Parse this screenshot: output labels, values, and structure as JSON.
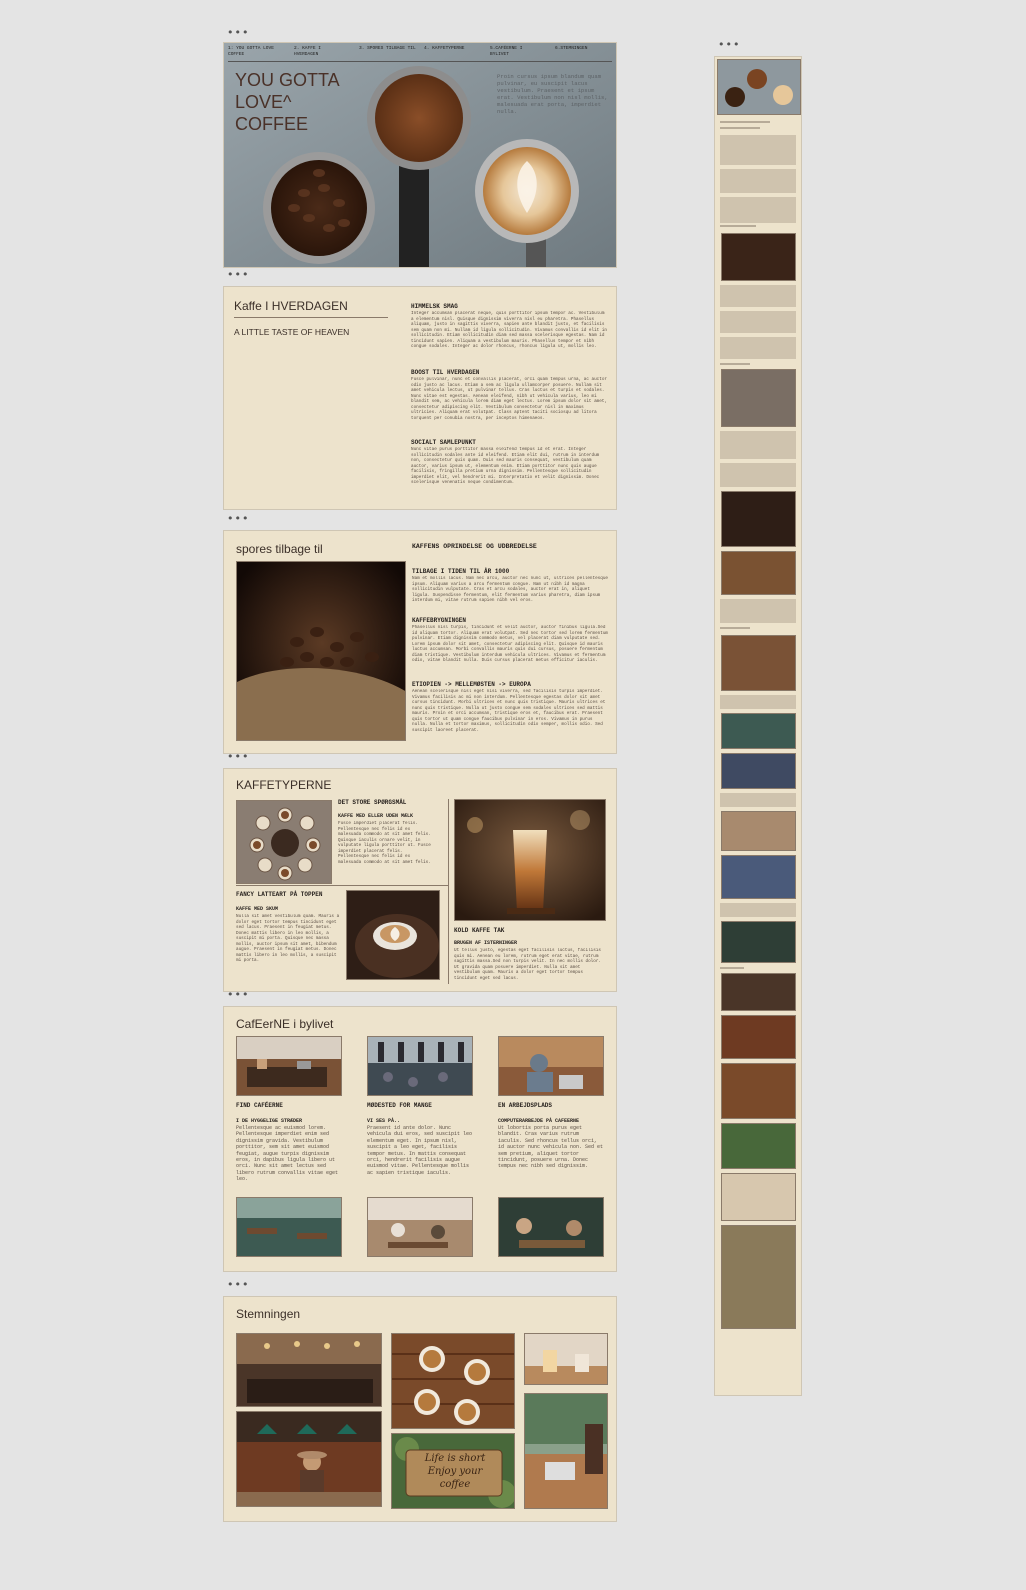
{
  "hero": {
    "nav": [
      "1: YOU GOTTA LOVE COFFEE",
      "2. KAFFE I HVERDAGEN",
      "3. SPORES TILBAGE TIL",
      "4. KAFFETYPERNE",
      "5.CAFÉERNE I BYLIVET",
      "6.STEMNINGEN"
    ],
    "title_lines": [
      "YOU GOTTA",
      "LOVE^",
      "COFFEE"
    ],
    "intro": "Proin cursus ipsum blandum quam pulvinar, eu suscipit lacus vestibulum. Praesent et ipsum erat. Vestibulum non nisl mollis, malesuada erat porta, imperdiet nulla."
  },
  "hverdagen": {
    "title": "Kaffe I HVERDAGEN",
    "subtitle": "A LITTLE TASTE OF HEAVEN",
    "sections": [
      {
        "heading": "HIMMELSK SMAG",
        "text": "Integer accumsan placerat neque, quis porttitor ipsum tempor ac. Vestibulum a elementum nisl. Quisque dignissim viverra nisl eu pharetra. Phasellus aliquam, justo in sagittis viverra, sapien ante blandit justo, et facilisis sem quam non mi. Nullam id ligula sollicitudin. Vivamus convallis id elit in sollicitudin. Etiam sollicitudin diam sed massa scelerisque egestas. Nam id tincidunt sapien. Aliquam a vestibulum mauris. Phasellus tempor et nibh congue sodales. Integer ac dolor rhoncus, rhoncus ligula ut, mollis leo."
      },
      {
        "heading": "BOOST TIL HVERDAGEN",
        "text": "Fusce pulvinar, nunc et convallis placerat, orci quam tempus urna, ac auctor odio justo ac lacus. Etiam a sem ac ligula ullamcorper posuere. Nullam sit amet vehicula lectus, ut pulvinar tellus. Cras luctus et turpis et sodales. Nunc vitae est egestas. Aenean eleifend, nibh ut vehicula varius, leo mi blandit sem, ac vehicula lorem diam eget lectus. Lorem ipsum dolor sit amet, consectetur adipiscing elit. Vestibulum consectetur nisl in maximus ultricies. Aliquam erat volutpat. Class aptent taciti sociosqu ad litora torquent per conubia nostra, per inceptos himenaeos."
      },
      {
        "heading": "SOCIALT SAMLEPUNKT",
        "text": "Nunc vitae purus porttitor massa eleifend tempus id et erat. Integer sollicitudin sodales ante id eleifend. Etiam elit dui, rutrum in interdum non, consectetur quis quam. Duis sed mauris consequat, vestibulum quam auctor, varius ipsum ut, elementum enim. Etiam porttitor nunc quis augue facilisis, fringilla pretium urna dignissim. Pellentesque sollicitudin imperdiet elit, vel hendrerit mi. Interpretatio et velit dignissim. Donec scelerisque venenatis neque condimentum."
      }
    ]
  },
  "spores": {
    "title": "spores tilbage til",
    "main_heading": "KAFFENS OPRINDELSE OG UDBREDELSE",
    "sections": [
      {
        "heading": "TILBAGE I TIDEN TIL ÅR 1000",
        "text": "Nam et mollis lacus. Nam nec arcu, auctor nec nunc ut, ultrices pellentesque ipsum. Aliquam varius a arcu fermentum congue. Nam ut nibh id magna sollicitudin vulputate. Cras et arcu sodales, auctor erat in, aliquet ligula. Suspendisse fermentum, elit fermentum varius pharetra, diam ipsum interdum mi, vitae rutrum sapien nibh vel eros."
      },
      {
        "heading": "KAFFEBRYGNINGEN",
        "text": "Phasellus nisl turpis, tincidunt et velit auctor, auctor finibus ligula.Sed id aliquam tortor. Aliquam erat volutpat. Sed nec tortor sed lorem fermentum pulvinar. Etiam dignissim commodo metus, vel placerat diam vulputate sed. Lorem ipsum dolor sit amet, consectetur adipiscing elit. Quisque id mauris luctus accumsan. Morbi convallis mauris quis dui cursus, posuere fermentum diam tristique. Vestibulum interdum vehicula ultrices. Vivamus et fermentum odio, vitae blandit nulla. Duis cursus placerat metus efficitur iaculis."
      },
      {
        "heading": "ETIOPIEN -> MELLEMØSTEN -> EUROPA",
        "text": "Aenean scelerisque nisl eget nisi viverra, sed facilisis turpis imperdiet. Vivamus facilisis ac mi non interdum. Pellentesque egestas dolor sit amet cursus tincidunt. Morbi ultrices et nunc quis tristique. Mauris ultrices et nunc quis tristique. Nulla ut justo congue sem sodales ultrices sed mattis mauris. Proin et orci accumsan, tristique eros et, faucibus erat. Praesent quis tortor ut quam congue faucibus pulvinar in eros. Vivamus in purus nulla. Nulla et tortor maximus, sollicitudin odio semper, mollis odio. Sed suscipit laoreet placerat."
      }
    ]
  },
  "kaffetyperne": {
    "title": "KAFFETYPERNE",
    "q_heading": "DET STORE SPØRGSMÅL",
    "q_sub": "KAFFE MED ELLER UDEN MÆLK",
    "q_text": "Fusce imperdiet placerat felis. Pellentesque nec felis id ex malesuada commodo at sit amet felis. Quisque iaculis ornare velit, in vulputate ligula porttitor ut. Fusce imperdiet placerat felis. Pellentesque nec felis id ex malesuada commodo at sit amet felis.",
    "latte_heading": "FANCY LATTEART PÅ TOPPEN",
    "latte_sub": "KAFFE MED SKUM",
    "latte_text": "Nulla sit amet vestibulum quam. Mauris a dolor eget tortor tempus tincidunt eget sed lacus. Praesent in feugiat metus. Donec mattis libero in leo mollis, a suscipit mi porta. Quisque nec massa mollis, auctor ipsum sit amet, bibendum augue. Praesent in feugiat metus. Donec mattis libero in leo mollis, a suscipit mi porta.",
    "cold_heading": "KOLD KAFFE TAK",
    "cold_sub": "BRUGEN AF ISTERNINGER",
    "cold_text": "Ut tellus justo, egestas eget facilisis luctus, facilisis quis mi. Aenean eu lorem, rutrum eget erat vitae, rutrum sagittis massa.Sed non turpis velit. In nec mollis dolor. Ut gravida quam posuere imperdiet. Nulla sit amet vestibulum quam. Mauris a dolor eget tortor tempus tincidunt eget sed lacus."
  },
  "cafeerne": {
    "title": "CafEerNE i bylivet",
    "columns": [
      {
        "heading": "FIND CAFÉERNE",
        "sub": "I DE HYGGELIGE STRÆDER",
        "text": "Pellentesque ac euismod lorem. Pellentesque imperdiet enim sed dignissim gravida. Vestibulum porttitor, sem sit amet euismod feugiat, augue turpis dignissim eros, in dapibus ligula libero ut orci. Nunc sit amet lectus sed libero rutrum convallis vitae eget leo."
      },
      {
        "heading": "MØDESTED FOR MANGE",
        "sub": "VI SES PÅ..",
        "text": "Praesent id ante dolor. Nunc vehicula dui eros, sed suscipit leo elementum eget. In ipsum nisl, suscipit a leo eget, facilisis tempor metus. In mattis consequat orci, hendrerit facilisis augue euismod vitae. Pellentesque mollis ac sapien tristique iaculis."
      },
      {
        "heading": "EN ARBEJDSPLADS",
        "sub": "COMPUTERARBEJDE PÅ CAFEERNE",
        "text": "Ut lobortis porta purus eget blandit. Cras varius rutrum iaculis. Sed rhoncus tellus orci, id auctor nunc vehicula non. Sed et sem pretium, aliquet tortor tincidunt, posuere urna. Donec tempus nec nibh sed dignissim."
      }
    ]
  },
  "stemningen": {
    "title": "Stemningen",
    "sign_text": [
      "Life is short",
      "Enjoy your",
      "coffee"
    ]
  },
  "icons": {
    "window_dots": "•••"
  }
}
